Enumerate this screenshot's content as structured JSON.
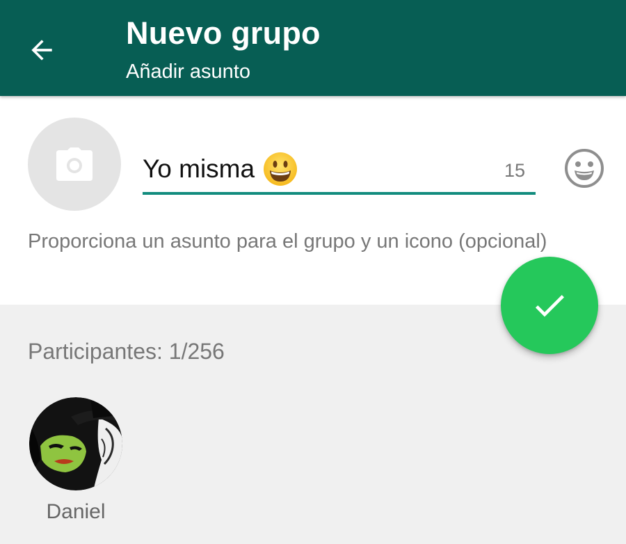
{
  "header": {
    "title": "Nuevo grupo",
    "subtitle": "Añadir asunto",
    "back_icon": "arrow-left-icon",
    "background_color": "#075e54"
  },
  "group_info": {
    "photo_icon": "camera-icon",
    "subject_value": "Yo misma",
    "subject_emoji": "grinning-face-emoji",
    "remaining_chars": "15",
    "emoji_button_icon": "smiley-icon",
    "hint": "Proporciona un asunto para el grupo y un icono (opcional)",
    "accent_color": "#128c7e"
  },
  "participants": {
    "label": "Participantes: 1/256",
    "members": [
      {
        "name": "Daniel"
      }
    ]
  },
  "fab": {
    "icon": "check-icon",
    "color": "#25c85b"
  }
}
